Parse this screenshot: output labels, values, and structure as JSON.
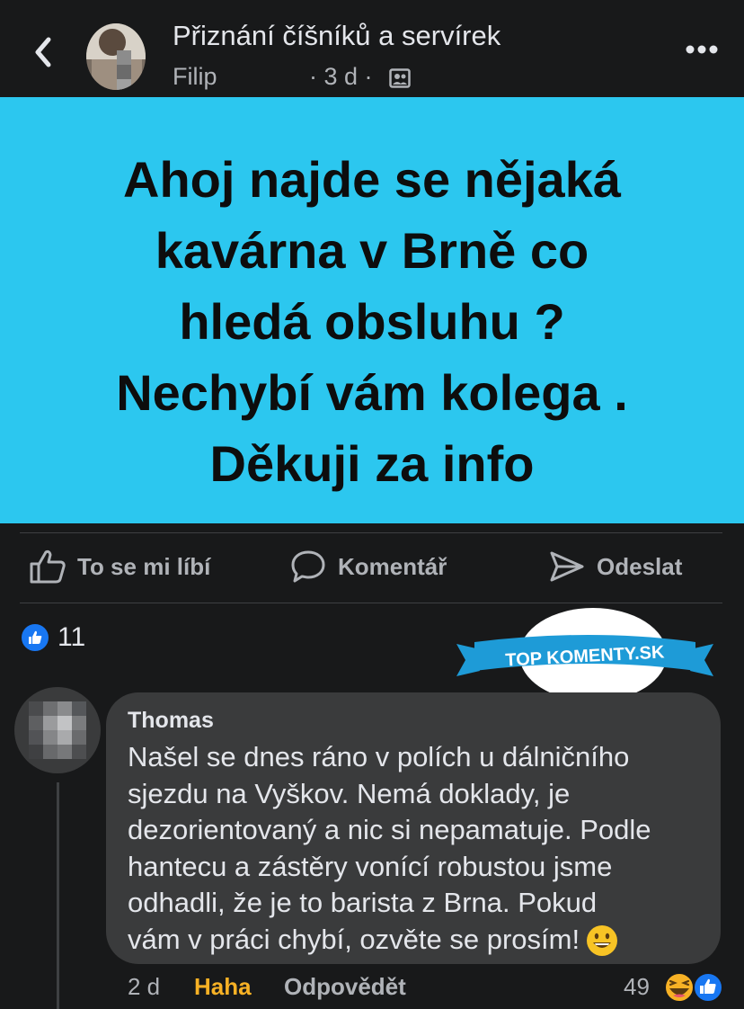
{
  "header": {
    "group_name": "Přiznání číšníků a servírek",
    "author": "Filip",
    "meta": "· 3 d ·",
    "icons": [
      "back-chevron-icon",
      "group-icon",
      "more-icon"
    ]
  },
  "post": {
    "background_color": "#2cc7ef",
    "text_lines": [
      "Ahoj najde se nějaká",
      "kavárna v Brně co",
      "hledá obsluhu ?",
      "Nechybí vám kolega .",
      "Děkuji za info"
    ]
  },
  "actions": {
    "like": "To se mi líbí",
    "comment": "Komentář",
    "share": "Odeslat"
  },
  "reactions": {
    "count": "11"
  },
  "watermark": {
    "text": "TOP KOMENTY.SK"
  },
  "comment": {
    "author": "Thomas",
    "lines": [
      "Našel se dnes ráno v polích u dálničního",
      "sjezdu na Vyškov. Nemá doklady, je",
      "dezorientovaný a nic si nepamatuje. Podle",
      "hantecu a zástěry vonící robustou jsme",
      "odhadli, že je to barista z Brna. Pokud",
      "vám v práci chybí, ozvěte se prosím!"
    ],
    "time": "2 d",
    "reaction_label": "Haha",
    "reply_label": "Odpovědět",
    "reaction_count": "49"
  }
}
